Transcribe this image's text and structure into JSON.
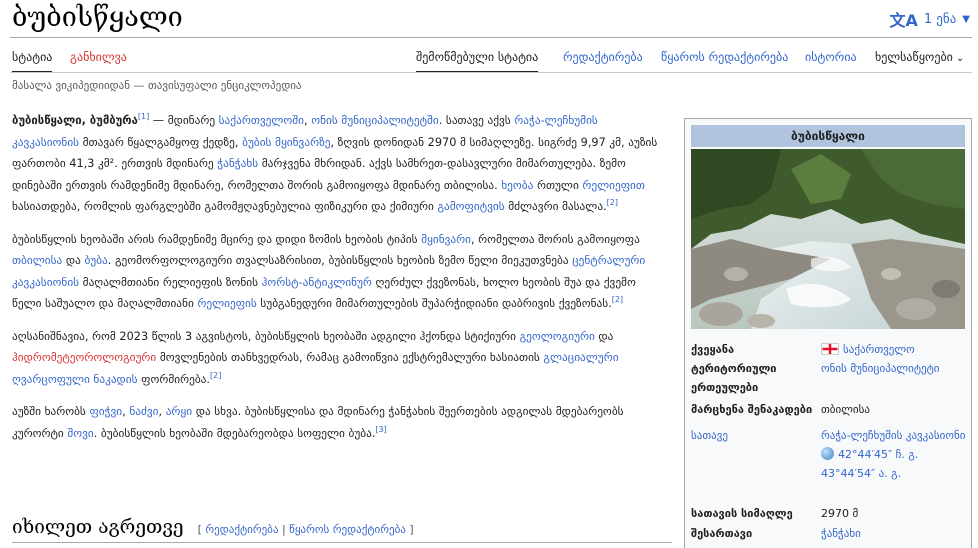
{
  "page": {
    "title": "ბუბისწყალი",
    "languages": {
      "icon": "translate-icon",
      "label": "1 ენა"
    },
    "tagline": "მასალა ვიკიპედიიდან — თავისუფალი ენციკლოპედია"
  },
  "tabs": {
    "article": "სტატია",
    "talk": "განხილვა",
    "reviewed": "შემოწმებული სტატია",
    "edit": "რედაქტირება",
    "edit_source": "წყაროს რედაქტირება",
    "history": "ისტორია",
    "tools": "ხელსაწყოები"
  },
  "content": {
    "p1": {
      "bold": "ბუბისწყალი, ბუმბურა",
      "ref1": "[1]",
      "t1": " — მდინარე ",
      "l1": "საქართველოში",
      "t2": ", ",
      "l2": "ონის მუნიციპალიტეტში",
      "t3": ". სათავე აქვს ",
      "l3": "რაჭა-ლეჩხუმის კავკასიონის",
      "t4": " მთავარ წყალგამყოფ ქედზე, ",
      "l4": "ბუბის მყინვარზე",
      "t5": ", ზღვის დონიდან 2970 მ სიმაღლეზე. სიგრძე 9,97 კმ, აუზის ფართობი 41,3 კმ². ერთვის მდინარე ",
      "l5": "ჭანჭახს",
      "t6": " მარჯვენა მხრიდან. აქვს სამხრეთ-დასავლური მიმართულება. ზემო დინებაში ერთვის რამდენიმე მდინარე, რომელთა შორის გამოიყოფა მდინარე თბილისა. ",
      "l6": "ხეობა",
      "t7": " რთული ",
      "l7": "რელიეფით",
      "t8": " ხასიათდება, რომლის ფარგლებში გამომჟღავნებულია ფიზიკური და ქიმიური ",
      "l8": "გამოფიტვის",
      "t9": " მძლავრი მასალა.",
      "ref2": "[2]"
    },
    "p2": {
      "t1": "ბუბისწყლის ხეობაში არის რამდენიმე მცირე და დიდი ზომის ხეობის ტიპის ",
      "l1": "მყინვარი",
      "t2": ", რომელთა შორის გამოიყოფა ",
      "l2": "თბილისა",
      "t3": " და ",
      "l3": "ბუბა",
      "t4": ". გეომორფოლოგიური თვალსაზრისით, ბუბისწყლის ხეობის ზემო წელი მიეკუთვნება ",
      "l4": "ცენტრალური კავკასიონის",
      "t5": " მაღალმთიანი რელიეფის ზონის ",
      "l5": "ჰორსტ-ანტიკლინურ",
      "t6": " ღერძულ ქვეზონას, ხოლო ხეობის შუა და ქვემო წელი საშუალო და მაღალმთიანი ",
      "l6": "რელიეფის",
      "t7": " სუბგანედური მიმართულების შუპარჭიდიანი დაბრივის ქვეზონას.",
      "ref": "[2]"
    },
    "p3": {
      "t1": "აღსანიშნავია, რომ 2023 წლის 3 აგვისტოს, ბუბისწყლის ხეობაში ადგილი ჰქონდა სტიქიური ",
      "l1": "გეოლოგიური",
      "t2": " და ",
      "l2": "ჰიდრომეტეოროლოგიური",
      "t3": " მოვლენების თანხვედრას, რამაც გამოიწვია ექსტრემალური ხასიათის ",
      "l3": "გლაციალური ღვარცოფული ნაკადის",
      "t4": " ფორმირება.",
      "ref": "[2]"
    },
    "p4": {
      "t1": "აუზში ხარობს ",
      "l1": "ფიჭვი",
      "t2": ", ",
      "l2": "ნაძვი",
      "t3": ", ",
      "l3": "არყი",
      "t4": " და სხვა. ბუბისწყლისა და მდინარე ჭანჭახის შეერთების ადგილას მდებარეობს კურორტი ",
      "l4": "შოვი",
      "t5": ". ბუბისწყლის ხეობაში მდებარეობდა სოფელი ბუბა.",
      "ref": "[3]"
    }
  },
  "section": {
    "heading": "იხილეთ აგრეთვე",
    "bracket_open": "[ ",
    "edit": "რედაქტირება",
    "sep": " | ",
    "edit_source": "წყაროს რედაქტირება",
    "bracket_close": " ]"
  },
  "infobox": {
    "title": "ბუბისწყალი",
    "image_alt": "mountain river photo",
    "country_label": "ქვეყანა",
    "country_value": "საქართველო",
    "region_label": "ტერიტორიული ერთეულები",
    "region_value": "ონის მუნიციპალიტეტი",
    "left_trib_label": "მარცხენა შენაკადები",
    "left_trib_value": "თბილისა",
    "source_label": "სათავე",
    "source_value": "რაჭა-ლეჩხუმის კავკასიონი",
    "coord_lat": "42°44′45″ ჩ. გ.",
    "coord_lon": "43°44′54″ ა. გ.",
    "source_alt_label": "სათავის სიმაღლე",
    "source_alt_value": "2970 მ",
    "mouth_label": "შესართავი",
    "mouth_value": "ჭანჭახი"
  },
  "colors": {
    "link": "#3366cc",
    "red_link": "#d73333",
    "infobox_header": "#b0c4de"
  }
}
